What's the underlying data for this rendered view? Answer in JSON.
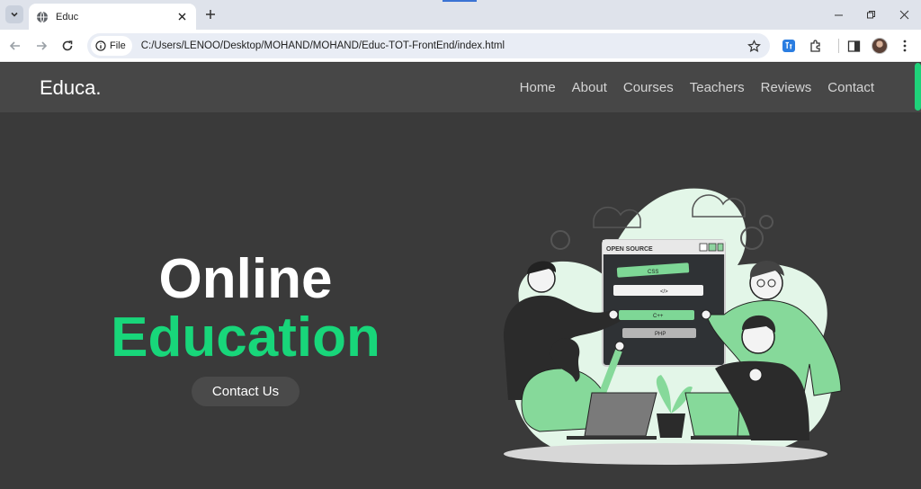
{
  "browser": {
    "tab_title": "Educ",
    "site_chip_label": "File",
    "url": "C:/Users/LENOO/Desktop/MOHAND/MOHAND/Educ-TOT-FrontEnd/index.html"
  },
  "header": {
    "logo": "Educa.",
    "nav": [
      "Home",
      "About",
      "Courses",
      "Teachers",
      "Reviews",
      "Contact"
    ]
  },
  "hero": {
    "title_line1": "Online",
    "title_line2": "Education",
    "button_label": "Contact Us"
  },
  "illustration": {
    "panel_title": "OPEN SOURCE",
    "code_tags": [
      "CSS",
      "</>",
      "C++",
      "PHP"
    ]
  },
  "colors": {
    "accent": "#18d67a",
    "page_bg": "#3a3a3a",
    "header_bg": "#474747",
    "button_bg": "#4a4a4a"
  }
}
